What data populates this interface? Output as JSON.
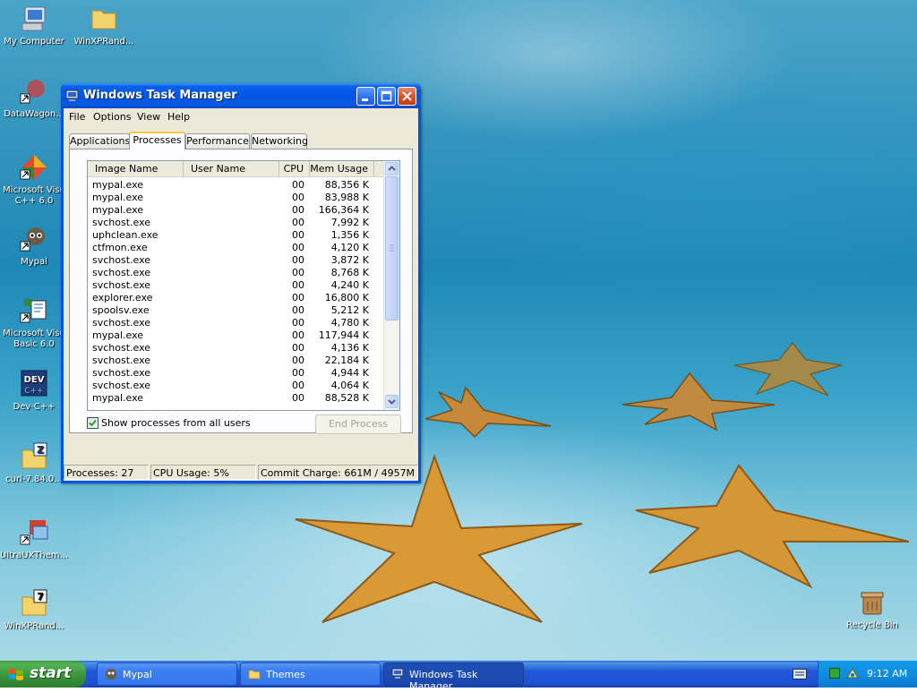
{
  "desktop": {
    "icons": [
      {
        "label": "My Computer",
        "icon": "computer-icon"
      },
      {
        "label": "WinXPRand...",
        "icon": "folder-icon"
      },
      {
        "label": "DataWagon...",
        "icon": "shortcut-icon"
      },
      {
        "label": "Microsoft Visu\nC++ 6.0",
        "icon": "visual-cpp-icon"
      },
      {
        "label": "Mypal",
        "icon": "mypal-icon"
      },
      {
        "label": "Microsoft Visu\nBasic 6.0",
        "icon": "visual-basic-icon"
      },
      {
        "label": "Dev-C++",
        "icon": "dev-cpp-icon"
      },
      {
        "label": "curl-7.84.0...",
        "icon": "zip-folder-icon"
      },
      {
        "label": "UltraUXThem...",
        "icon": "shortcut-icon"
      },
      {
        "label": "WinXPRand...",
        "icon": "zip-7-icon"
      },
      {
        "label": "Recycle Bin",
        "icon": "recycle-bin-icon"
      }
    ]
  },
  "window": {
    "title": "Windows Task Manager",
    "menu": [
      "File",
      "Options",
      "View",
      "Help"
    ],
    "tabs": [
      {
        "label": "Applications"
      },
      {
        "label": "Processes"
      },
      {
        "label": "Performance"
      },
      {
        "label": "Networking"
      }
    ],
    "columns": {
      "image_name": "Image Name",
      "user_name": "User Name",
      "cpu": "CPU",
      "mem": "Mem Usage"
    },
    "processes": [
      {
        "name": "mypal.exe",
        "cpu": "00",
        "mem": "88,356 K"
      },
      {
        "name": "mypal.exe",
        "cpu": "00",
        "mem": "83,988 K"
      },
      {
        "name": "mypal.exe",
        "cpu": "00",
        "mem": "166,364 K"
      },
      {
        "name": "svchost.exe",
        "cpu": "00",
        "mem": "7,992 K"
      },
      {
        "name": "uphclean.exe",
        "cpu": "00",
        "mem": "1,356 K"
      },
      {
        "name": "ctfmon.exe",
        "cpu": "00",
        "mem": "4,120 K"
      },
      {
        "name": "svchost.exe",
        "cpu": "00",
        "mem": "3,872 K"
      },
      {
        "name": "svchost.exe",
        "cpu": "00",
        "mem": "8,768 K"
      },
      {
        "name": "svchost.exe",
        "cpu": "00",
        "mem": "4,240 K"
      },
      {
        "name": "explorer.exe",
        "cpu": "00",
        "mem": "16,800 K"
      },
      {
        "name": "spoolsv.exe",
        "cpu": "00",
        "mem": "5,212 K"
      },
      {
        "name": "svchost.exe",
        "cpu": "00",
        "mem": "4,780 K"
      },
      {
        "name": "mypal.exe",
        "cpu": "00",
        "mem": "117,944 K"
      },
      {
        "name": "svchost.exe",
        "cpu": "00",
        "mem": "4,136 K"
      },
      {
        "name": "svchost.exe",
        "cpu": "00",
        "mem": "22,184 K"
      },
      {
        "name": "svchost.exe",
        "cpu": "00",
        "mem": "4,944 K"
      },
      {
        "name": "svchost.exe",
        "cpu": "00",
        "mem": "4,064 K"
      },
      {
        "name": "mypal.exe",
        "cpu": "00",
        "mem": "88,528 K"
      }
    ],
    "show_all_label": "Show processes from all users",
    "show_all_checked": true,
    "end_process_label": "End Process",
    "status": {
      "processes": "Processes: 27",
      "cpu": "CPU Usage: 5%",
      "commit": "Commit Charge: 661M / 4957M"
    }
  },
  "taskbar": {
    "start_label": "start",
    "buttons": [
      {
        "label": "Mypal",
        "icon": "mypal-icon"
      },
      {
        "label": "Themes",
        "icon": "folder-icon"
      },
      {
        "label": "Windows Task Manager",
        "icon": "task-manager-icon"
      }
    ],
    "clock": "9:12 AM"
  },
  "colors": {
    "title_blue": "#0054e3",
    "start_green": "#379237",
    "tray_blue": "#0f8ce0"
  }
}
